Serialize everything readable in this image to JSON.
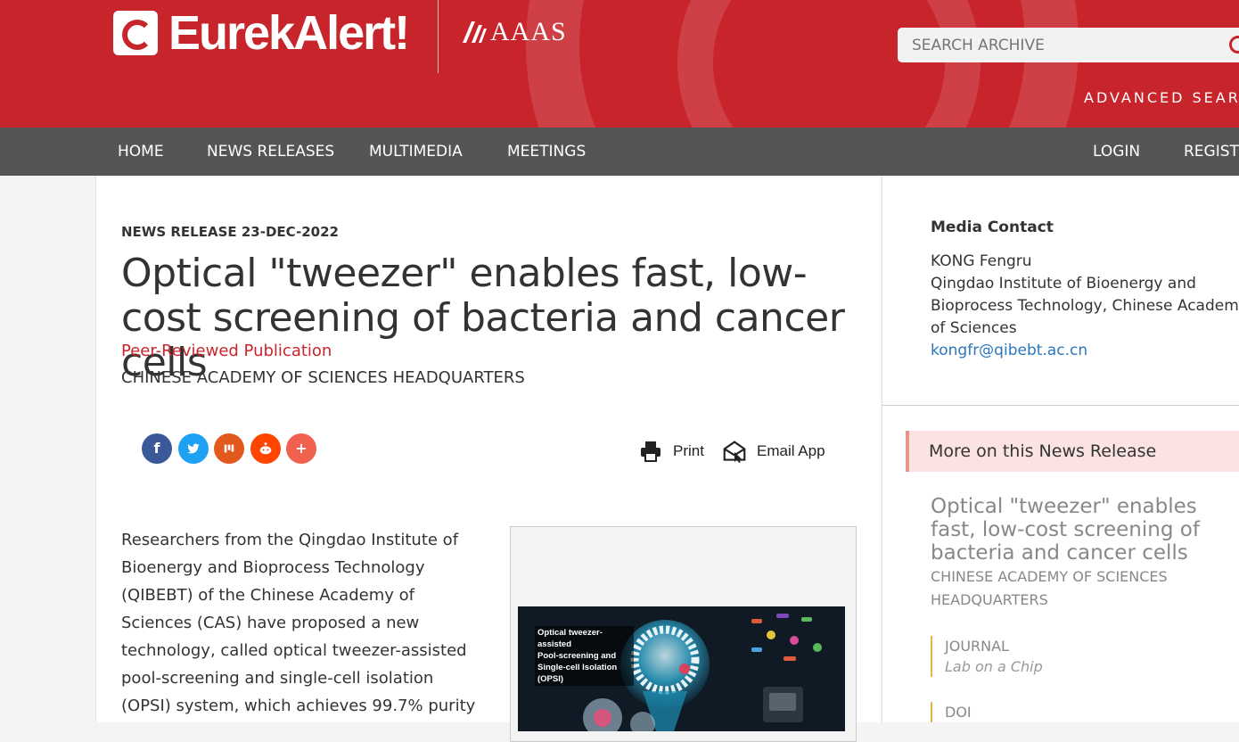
{
  "header": {
    "logo_text": "EurekAlert!",
    "aaas_text": "AAAS",
    "search_placeholder": "SEARCH ARCHIVE",
    "advanced_search": "ADVANCED SEARCH"
  },
  "nav": {
    "home": "HOME",
    "news_releases": "NEWS RELEASES",
    "multimedia": "MULTIMEDIA",
    "meetings": "MEETINGS",
    "login": "LOGIN",
    "register": "REGISTER"
  },
  "article": {
    "kicker": "NEWS RELEASE 23-DEC-2022",
    "title": "Optical \"tweezer\" enables fast, low-cost screening of bacteria and cancer cells",
    "peer_reviewed": "Peer-Reviewed Publication",
    "organization": "CHINESE ACADEMY OF SCIENCES HEADQUARTERS",
    "share_icons": [
      "facebook-icon",
      "twitter-icon",
      "mix-icon",
      "reddit-icon",
      "more-icon"
    ],
    "print_label": "Print",
    "email_label": "Email App",
    "body_lines": [
      "Researchers from the Qingdao Institute of",
      "Bioenergy and Bioprocess Technology",
      "(QIBEBT) of the Chinese Academy of",
      "Sciences (CAS) have proposed a new",
      "technology, called optical tweezer-assisted",
      "pool-screening and single-cell isolation",
      "(OPSI) system, which achieves 99.7% purity"
    ],
    "figure_caption": [
      "Optical tweezer-assisted",
      "Pool-screening and",
      "Single-cell Isolation",
      "(OPSI)"
    ]
  },
  "sidebar": {
    "media_contact_heading": "Media Contact",
    "contact_name": "KONG Fengru",
    "contact_org_lines": [
      "Qingdao Institute of Bioenergy and",
      "Bioprocess Technology, Chinese Academy",
      "of Sciences"
    ],
    "contact_email": "kongfr@qibebt.ac.cn",
    "more_heading": "More on this News Release",
    "related_title": "Optical \"tweezer\" enables fast, low-cost screening of bacteria and cancer cells",
    "related_org": "CHINESE ACADEMY OF SCIENCES HEADQUARTERS",
    "journal_label": "JOURNAL",
    "journal_value": "Lab on a Chip",
    "doi_label": "DOI"
  },
  "colors": {
    "brand_red": "#c8242b",
    "nav_gray": "#555555",
    "link_blue": "#2a76bd",
    "facebook": "#3b5998",
    "twitter": "#1da1f2",
    "mix": "#e2581d",
    "reddit": "#ff4500",
    "more": "#f0624f"
  }
}
